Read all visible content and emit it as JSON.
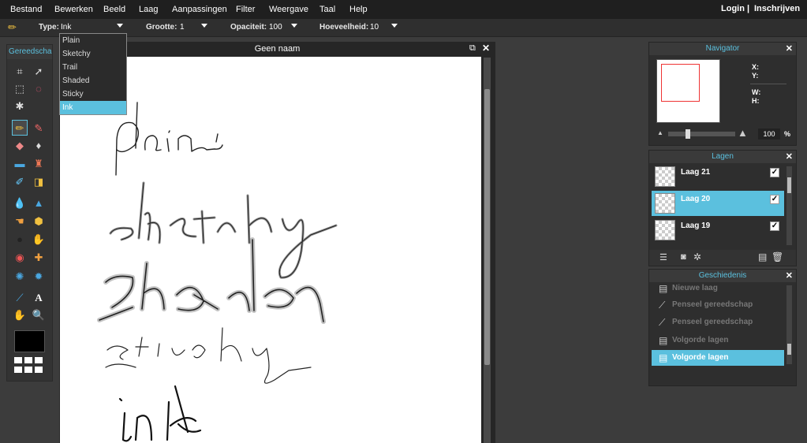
{
  "menu": {
    "items": [
      "Bestand",
      "Bewerken",
      "Beeld",
      "Laag",
      "Aanpassingen",
      "Filter",
      "Weergave",
      "Taal",
      "Help"
    ],
    "login": "Login",
    "separator": "|",
    "register": "Inschrijven"
  },
  "options": {
    "tool_icon": "pencil-icon",
    "type_label": "Type:",
    "type_value": "Ink",
    "size_label": "Grootte:",
    "size_value": "1",
    "opacity_label": "Opaciteit:",
    "opacity_value": "100",
    "amount_label": "Hoeveelheid:",
    "amount_value": "10"
  },
  "type_dropdown": {
    "options": [
      "Plain",
      "Sketchy",
      "Trail",
      "Shaded",
      "Sticky",
      "Ink"
    ],
    "selected": "Ink"
  },
  "tools": {
    "title": "Gereedscha",
    "icons": [
      "crop-icon",
      "move-icon",
      "marquee-icon",
      "lasso-icon",
      "magic-wand-icon",
      "pencil-icon",
      "brush-icon",
      "eraser-icon",
      "bucket-icon",
      "gradient-icon",
      "stamp-icon",
      "replace-color-icon",
      "picker-icon",
      "blur-icon",
      "sharpen-icon",
      "smudge-icon",
      "sponge-icon",
      "dodge-icon",
      "burn-icon",
      "red-eye-icon",
      "spot-heal-icon",
      "bloat-icon",
      "pinch-icon",
      "color-picker-icon",
      "text-icon",
      "hand-icon",
      "zoom-icon"
    ],
    "primary_color": "#000000"
  },
  "document": {
    "title": "Geen naam",
    "words": [
      "plain",
      "sketchy",
      "shaded",
      "sticky",
      "ink"
    ]
  },
  "navigator": {
    "title": "Navigator",
    "x_label": "X:",
    "y_label": "Y:",
    "w_label": "W:",
    "h_label": "H:",
    "zoom": "100",
    "zoom_unit": "%"
  },
  "layers": {
    "title": "Lagen",
    "items": [
      {
        "name": "Laag 21",
        "selected": false,
        "visible": true
      },
      {
        "name": "Laag 20",
        "selected": true,
        "visible": true
      },
      {
        "name": "Laag 19",
        "selected": false,
        "visible": true
      }
    ]
  },
  "history": {
    "title": "Geschiedenis",
    "items": [
      {
        "name": "Nieuwe laag",
        "selected": false
      },
      {
        "name": "Penseel gereedschap",
        "selected": false
      },
      {
        "name": "Penseel gereedschap",
        "selected": false
      },
      {
        "name": "Volgorde lagen",
        "selected": false
      },
      {
        "name": "Volgorde lagen",
        "selected": true
      }
    ]
  },
  "colors": {
    "accent": "#5bc0de",
    "menubar": "#1f1f1f",
    "panel": "#2e2e2e"
  }
}
